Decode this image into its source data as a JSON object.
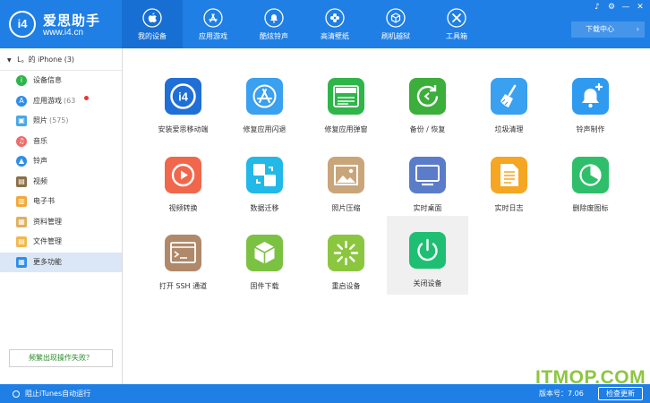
{
  "header": {
    "logo_name": "爱思助手",
    "logo_url": "www.i4.cn",
    "logo_badge": "i4",
    "nav": [
      {
        "label": "我的设备",
        "icon": "apple-icon"
      },
      {
        "label": "应用游戏",
        "icon": "app-store-icon"
      },
      {
        "label": "酷炫铃声",
        "icon": "bell-icon"
      },
      {
        "label": "高清壁纸",
        "icon": "flower-icon"
      },
      {
        "label": "刷机越狱",
        "icon": "box-icon"
      },
      {
        "label": "工具箱",
        "icon": "tools-icon"
      }
    ],
    "download_center": "下载中心",
    "window_controls": [
      "♪",
      "⚙",
      "—",
      "✕"
    ]
  },
  "sidebar": {
    "device": "L。的 iPhone (3)",
    "items": [
      {
        "label": "设备信息",
        "count": "",
        "icon": "info-icon",
        "color": "#2fb54a",
        "glyph": "i"
      },
      {
        "label": "应用游戏",
        "count": "(63",
        "icon": "app-icon",
        "color": "#2e8ee8",
        "glyph": "A"
      },
      {
        "label": "照片",
        "count": "(575)",
        "icon": "photo-icon",
        "color": "#4aa6e8",
        "glyph": "▣"
      },
      {
        "label": "音乐",
        "count": "",
        "icon": "music-icon",
        "color": "#f06a6a",
        "glyph": "♫"
      },
      {
        "label": "铃声",
        "count": "",
        "icon": "bell-icon",
        "color": "#2e8ee8",
        "glyph": "▲"
      },
      {
        "label": "视频",
        "count": "",
        "icon": "video-icon",
        "color": "#8b6f45",
        "glyph": "▤"
      },
      {
        "label": "电子书",
        "count": "",
        "icon": "book-icon",
        "color": "#f2a83a",
        "glyph": "▥"
      },
      {
        "label": "资料管理",
        "count": "",
        "icon": "contacts-icon",
        "color": "#e0b060",
        "glyph": "▦"
      },
      {
        "label": "文件管理",
        "count": "",
        "icon": "file-icon",
        "color": "#f2b84a",
        "glyph": "▤"
      },
      {
        "label": "更多功能",
        "count": "",
        "icon": "grid-icon",
        "color": "#2e8ee8",
        "glyph": "▦"
      }
    ],
    "feedback": "频繁出现操作失败？"
  },
  "tools": [
    {
      "label": "安装爱思移动端",
      "icon": "i4-app-icon",
      "color": "#1f6fd6"
    },
    {
      "label": "修复应用闪退",
      "icon": "appstore-repair-icon",
      "color": "#3aa0f0"
    },
    {
      "label": "修复应用弹窗",
      "icon": "apple-id-icon",
      "color": "#2fb54a",
      "text": "Apple ID"
    },
    {
      "label": "备份 / 恢复",
      "icon": "backup-restore-icon",
      "color": "#3cae3c"
    },
    {
      "label": "垃圾清理",
      "icon": "broom-icon",
      "color": "#3aa0f0"
    },
    {
      "label": "铃声制作",
      "icon": "bell-plus-icon",
      "color": "#2e9af0"
    },
    {
      "label": "视频转换",
      "icon": "video-play-icon",
      "color": "#f0674b"
    },
    {
      "label": "数据迁移",
      "icon": "migrate-icon",
      "color": "#22b8e8"
    },
    {
      "label": "照片压缩",
      "icon": "image-compress-icon",
      "color": "#c9a57a"
    },
    {
      "label": "实时桌面",
      "icon": "monitor-icon",
      "color": "#5b7cc9"
    },
    {
      "label": "实时日志",
      "icon": "log-icon",
      "color": "#f5a623"
    },
    {
      "label": "删除废图标",
      "icon": "pie-icon",
      "color": "#2fbf6a"
    },
    {
      "label": "打开 SSH 通道",
      "icon": "terminal-icon",
      "color": "#b0896a",
      "text": "SSH"
    },
    {
      "label": "固件下载",
      "icon": "cube-icon",
      "color": "#7cc242"
    },
    {
      "label": "重启设备",
      "icon": "spinner-icon",
      "color": "#8bc63f"
    },
    {
      "label": "关闭设备",
      "icon": "power-icon",
      "color": "#1fbf73"
    }
  ],
  "status": {
    "itunes": "阻止iTunes自动运行",
    "version": "版本号：7.06",
    "update": "检查更新"
  },
  "watermark": "ITMOP.COM"
}
